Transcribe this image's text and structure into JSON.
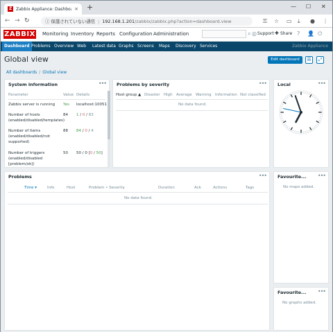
{
  "browser": {
    "tab_title": "Zabbix Appliance: Dashboard",
    "tab_close": "×",
    "new_tab": "+",
    "security_warning": "ⓘ 保護されていない通信",
    "url_host": "192.168.1.201",
    "url_path": "/zabbix/zabbix.php?action=dashboard.view",
    "win_min": "—",
    "win_max": "☐",
    "win_close": "✕"
  },
  "header": {
    "logo": "ZABBIX",
    "menu": [
      "Monitoring",
      "Inventory",
      "Reports",
      "Configuration",
      "Administration"
    ],
    "support": "Support",
    "share": "Share"
  },
  "subnav": {
    "items": [
      "Dashboard",
      "Problems",
      "Overview",
      "Web",
      "Latest data",
      "Graphs",
      "Screens",
      "Maps",
      "Discovery",
      "Services"
    ],
    "appliance": "Zabbix Appliance"
  },
  "page": {
    "title": "Global view",
    "edit_button": "Edit dashboard",
    "breadcrumb": [
      "All dashboards",
      "Global view"
    ],
    "breadcrumb_sep": "/"
  },
  "system_info": {
    "title": "System information",
    "headers": [
      "Parameter",
      "Value",
      "Details"
    ],
    "rows": [
      {
        "param": "Zabbix server is running",
        "value": "Yes",
        "details": "localhost:10051"
      },
      {
        "param": "Number of hosts (enabled/disabled/templates)",
        "value": "84",
        "d1": "1",
        "d2": "0",
        "d3": "83"
      },
      {
        "param": "Number of items (enabled/disabled/not supported)",
        "value": "88",
        "d1": "84",
        "d2": "0",
        "d3": "4"
      },
      {
        "param": "Number of triggers (enabled/disabled [problem/ok])",
        "value": "50",
        "d1": "50",
        "d2": "0",
        "d3": "0",
        "d4": "50"
      }
    ]
  },
  "problems_severity": {
    "title": "Problems by severity",
    "headers": [
      "Host group ▲",
      "Disaster",
      "High",
      "Average",
      "Warning",
      "Information",
      "Not classified"
    ],
    "no_data": "No data found."
  },
  "local_clock": {
    "title": "Local",
    "hours": 6,
    "minutes": 56,
    "seconds": 47
  },
  "problems": {
    "title": "Problems",
    "headers": [
      "Time ▾",
      "Info",
      "Host",
      "Problem • Severity",
      "Duration",
      "Ack",
      "Actions",
      "Tags"
    ],
    "no_data": "No data found."
  },
  "fav_maps": {
    "title": "Favourite...",
    "empty": "No maps added."
  },
  "fav_graphs": {
    "title": "Favourite...",
    "empty": "No graphs added."
  },
  "colors": {
    "brand": "#d40000",
    "nav": "#0a466a",
    "nav_active": "#1c7ec3",
    "link": "#0275b8",
    "green": "#429e47",
    "red": "#e45959"
  }
}
